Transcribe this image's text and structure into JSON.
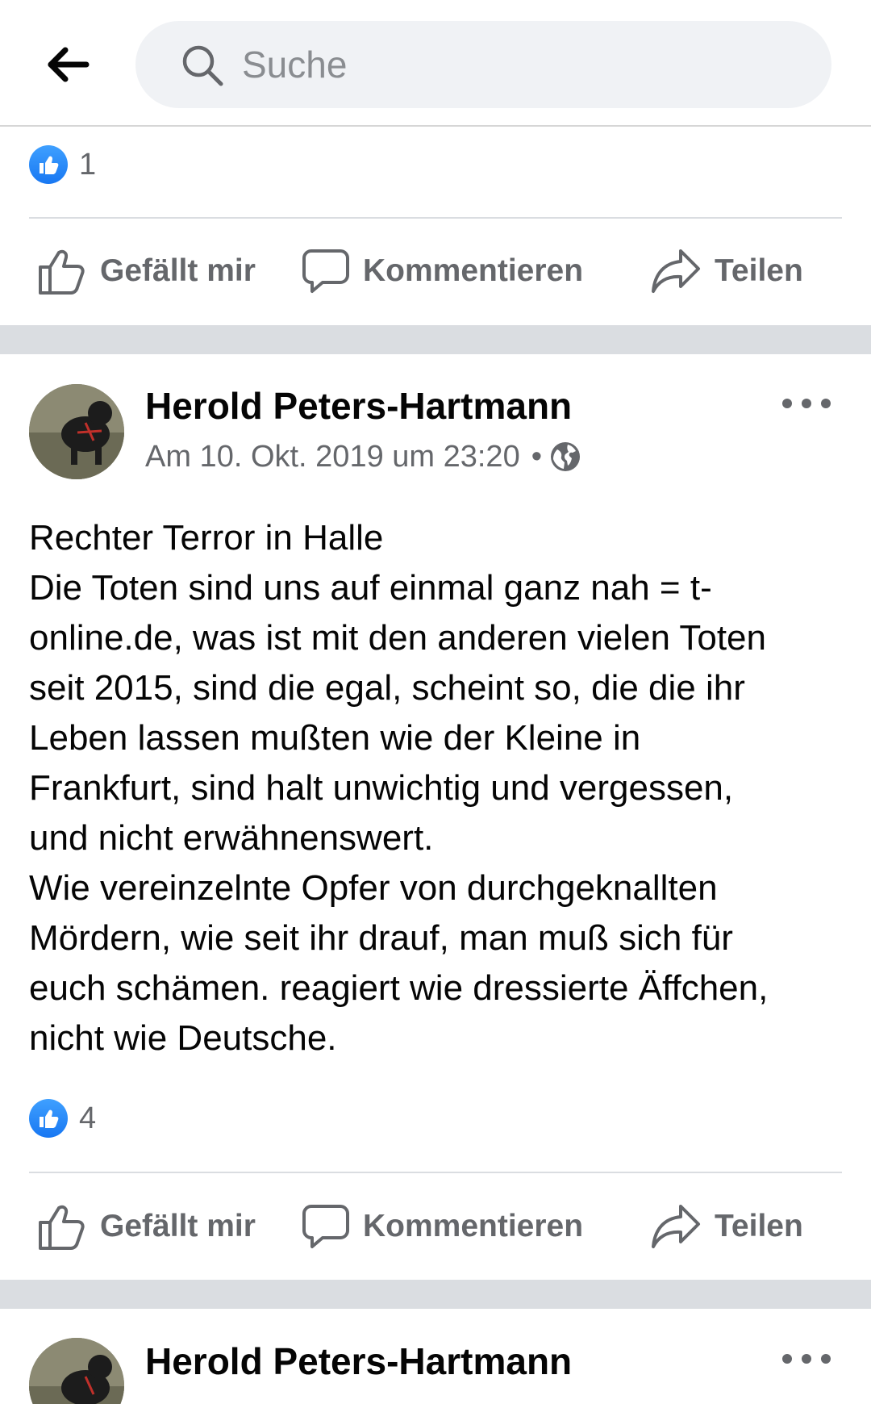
{
  "header": {
    "search_placeholder": "Suche"
  },
  "previous_post": {
    "like_count": "1",
    "actions": {
      "like": "Gefällt mir",
      "comment": "Kommentieren",
      "share": "Teilen"
    }
  },
  "post": {
    "author": "Herold Peters-Hartmann",
    "timestamp": "Am 10. Okt. 2019 um 23:20",
    "separator_dot": "•",
    "audience_icon": "globe-icon",
    "text_lines": [
      "Rechter Terror in Halle",
      "Die Toten sind uns auf einmal ganz nah = t-",
      "online.de, was ist mit den anderen vielen Toten",
      "seit 2015, sind die egal, scheint so, die die ihr",
      "Leben lassen mußten wie der Kleine in",
      "Frankfurt, sind halt unwichtig und vergessen,",
      "und nicht erwähnenswert.",
      "Wie vereinzelnte Opfer von durchgeknallten",
      "Mördern, wie seit ihr drauf, man muß sich für",
      "euch schämen. reagiert wie dressierte Äffchen,",
      "nicht wie Deutsche."
    ],
    "like_count": "4",
    "actions": {
      "like": "Gefällt mir",
      "comment": "Kommentieren",
      "share": "Teilen"
    }
  },
  "next_post": {
    "author": "Herold Peters-Hartmann"
  },
  "colors": {
    "like_blue": "#1877f2",
    "secondary_text": "#65676b",
    "separator": "#dadde1",
    "search_bg": "#f0f2f5"
  }
}
